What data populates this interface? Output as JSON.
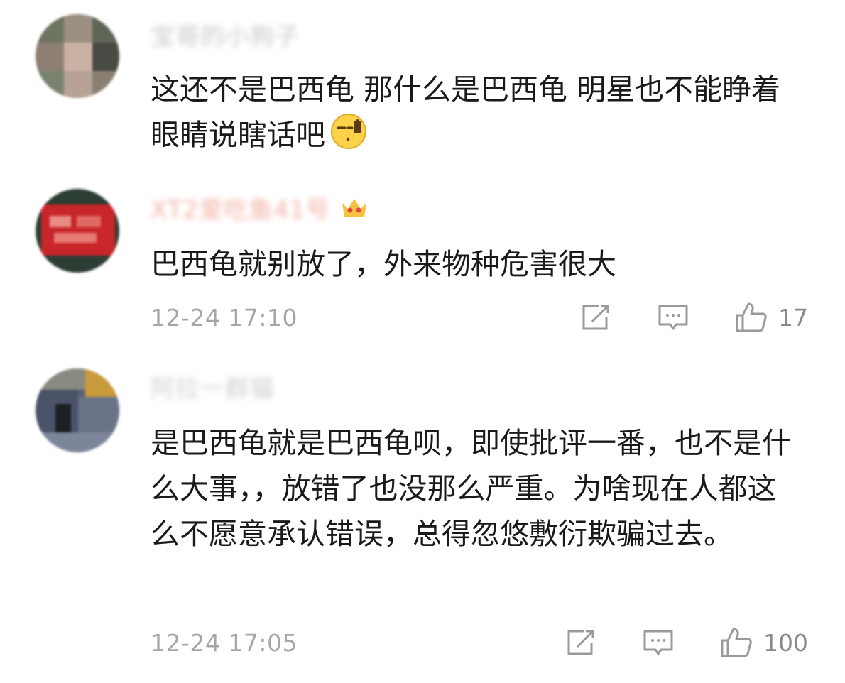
{
  "comments": [
    {
      "username": "宝哥的小狗子",
      "text": "这还不是巴西龟 那什么是巴西龟 明星也不能睁着眼睛说瞎话吧",
      "emoji": "facepalm-smile-emoji"
    },
    {
      "username": "XT2爱吃鱼41号",
      "badge": "crown-icon",
      "text": "巴西龟就别放了，外来物种危害很大",
      "timestamp": "12-24 17:10",
      "likes": "17"
    },
    {
      "username": "阿拉一群猫",
      "text": "是巴西龟就是巴西龟呗，即使批评一番，也不是什么大事，，放错了也没那么严重。为啥现在人都这么不愿意承认错误，总得忽悠敷衍欺骗过去。",
      "timestamp": "12-24 17:05",
      "likes": "100"
    }
  ],
  "colors": {
    "text": "#1a1a1a",
    "meta": "#a6a6a6",
    "icon": "#9a9a9a"
  }
}
